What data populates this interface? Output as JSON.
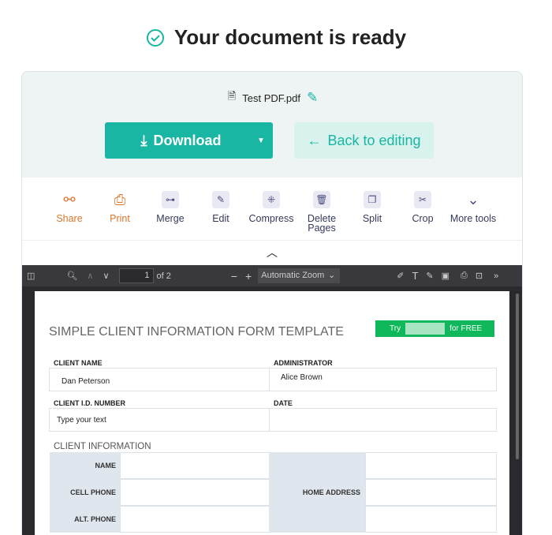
{
  "header": {
    "title": "Your document is ready"
  },
  "file": {
    "name": "Test PDF.pdf"
  },
  "actions": {
    "download": "Download",
    "back": "Back to editing"
  },
  "tools": [
    {
      "label": "Share",
      "icon": "share-icon"
    },
    {
      "label": "Print",
      "icon": "printer-icon"
    },
    {
      "label": "Merge",
      "icon": "merge-icon"
    },
    {
      "label": "Edit",
      "icon": "pencil-icon"
    },
    {
      "label": "Compress",
      "icon": "compress-icon"
    },
    {
      "label": "Delete Pages",
      "icon": "trash-icon"
    },
    {
      "label": "Split",
      "icon": "split-icon"
    },
    {
      "label": "Crop",
      "icon": "crop-icon"
    },
    {
      "label": "More tools",
      "icon": "chevron-down-icon"
    }
  ],
  "viewer": {
    "page": "1",
    "of": "of 2",
    "zoom": "Automatic Zoom"
  },
  "doc": {
    "title": "SIMPLE CLIENT INFORMATION FORM TEMPLATE",
    "try": "Try",
    "free": "for FREE",
    "client_name_label": "CLIENT NAME",
    "client_name": "Dan Peterson",
    "admin_label": "ADMINISTRATOR",
    "admin": "Alice Brown",
    "id_label": "CLIENT I.D. NUMBER",
    "id_value": "Type your text",
    "date_label": "DATE",
    "section": "CLIENT INFORMATION",
    "name": "NAME",
    "cell": "CELL PHONE",
    "alt": "ALT. PHONE",
    "home": "HOME ADDRESS"
  },
  "colors": {
    "accent": "#18b6a3",
    "orange": "#d9762a",
    "green": "#0fb85a"
  }
}
